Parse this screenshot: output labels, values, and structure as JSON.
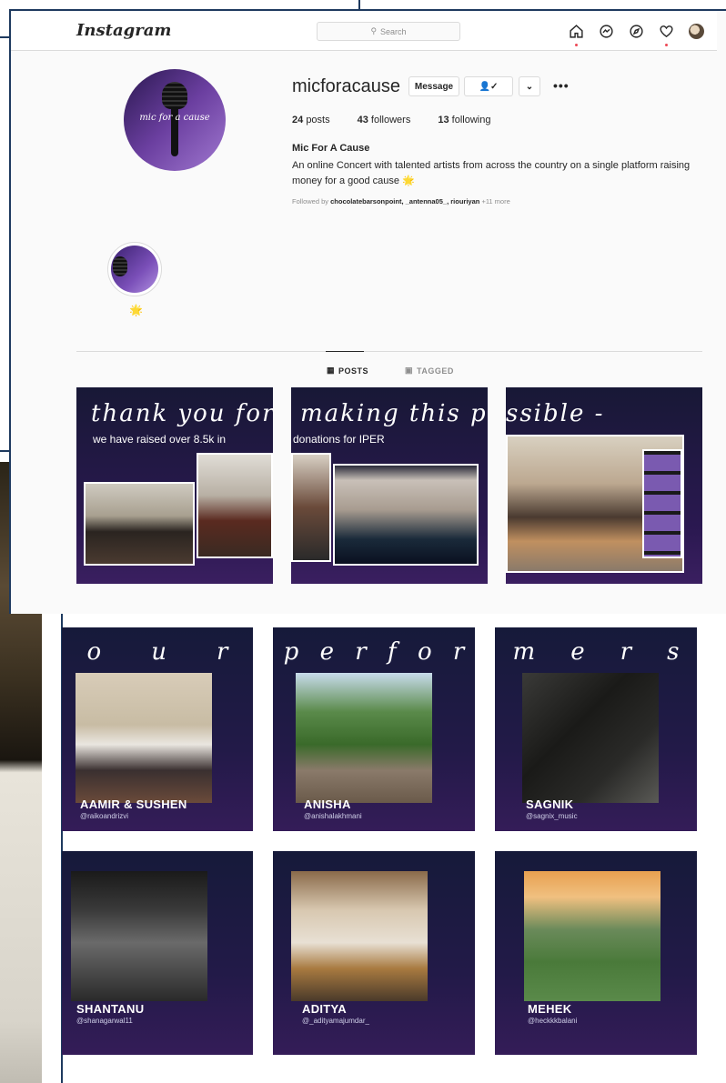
{
  "topbar": {
    "logo": "Instagram",
    "search_placeholder": "Search"
  },
  "profile": {
    "username": "micforacause",
    "picture_text": "mic for a cause",
    "message_button": "Message",
    "posts_count": "24",
    "posts_label": "posts",
    "followers_count": "43",
    "followers_label": "followers",
    "following_count": "13",
    "following_label": "following",
    "name": "Mic For A Cause",
    "bio": "An online Concert with talented artists from across the country on a single platform raising money for a good cause 🌟",
    "followed_by_prefix": "Followed by",
    "followed_by_names": "chocolatebarsonpoint, _antenna05_, riouriyan",
    "followed_by_more": "+11 more"
  },
  "highlight": {
    "emoji": "🌟"
  },
  "tabs": {
    "posts": "POSTS",
    "tagged": "TAGGED"
  },
  "tiles": [
    {
      "script": "thank you for",
      "sub": "we have raised over 8.5k in"
    },
    {
      "script": "making this po",
      "sub": "donations for IPER"
    },
    {
      "script": "ssible -",
      "sub": ""
    }
  ],
  "performers_header": {
    "row1": [
      "o",
      "u",
      "r"
    ],
    "row2": [
      "p",
      "e",
      "r",
      "f",
      "o",
      "r"
    ],
    "row3": [
      "m",
      "e",
      "r",
      "s"
    ]
  },
  "performers": [
    {
      "name": "AAMIR & SUSHEN",
      "handle": "@raikoandrizvi"
    },
    {
      "name": "ANISHA",
      "handle": "@anishalakhmani"
    },
    {
      "name": "SAGNIK",
      "handle": "@sagnix_music"
    },
    {
      "name": "SHANTANU",
      "handle": "@shanagarwal11"
    },
    {
      "name": "ADITYA",
      "handle": "@_adityamajumdar_"
    },
    {
      "name": "MEHEK",
      "handle": "@heckkkbalani"
    }
  ],
  "colors": {
    "tile_bg": "#221a48",
    "frame": "#1e3a5f",
    "notification_dot": "#ed4956"
  }
}
